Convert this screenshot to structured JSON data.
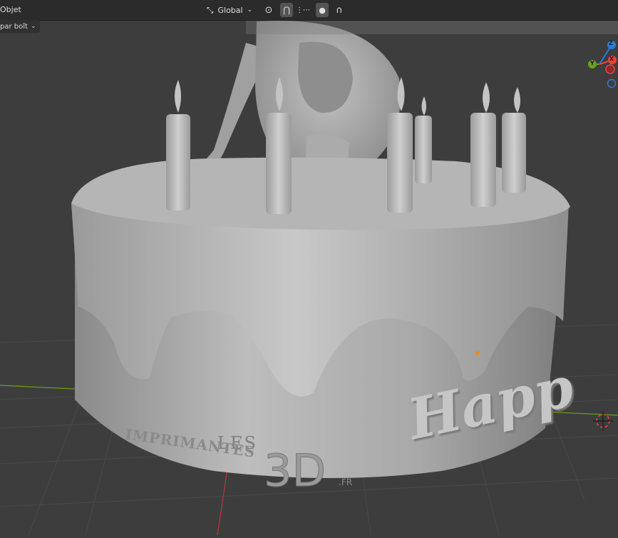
{
  "header": {
    "mode_label": "Objet",
    "orientation_label": "Global"
  },
  "subheader": {
    "select_mode_label": "par boît"
  },
  "scene": {
    "cake_text": "Happ",
    "watermark_les": "LES",
    "watermark_imprimantes": "IMPRIMANTES",
    "watermark_3d": "3D",
    "watermark_fr": ".FR"
  },
  "gizmo": {
    "z_label": "Z",
    "y_label": "Y",
    "x_label": "X"
  },
  "colors": {
    "bg": "#3d3d3d",
    "header": "#2b2b2b",
    "model": "#a9a9a9",
    "axis_x": "#e8443c",
    "axis_y": "#6c9d24",
    "axis_z": "#2d7bd2"
  }
}
